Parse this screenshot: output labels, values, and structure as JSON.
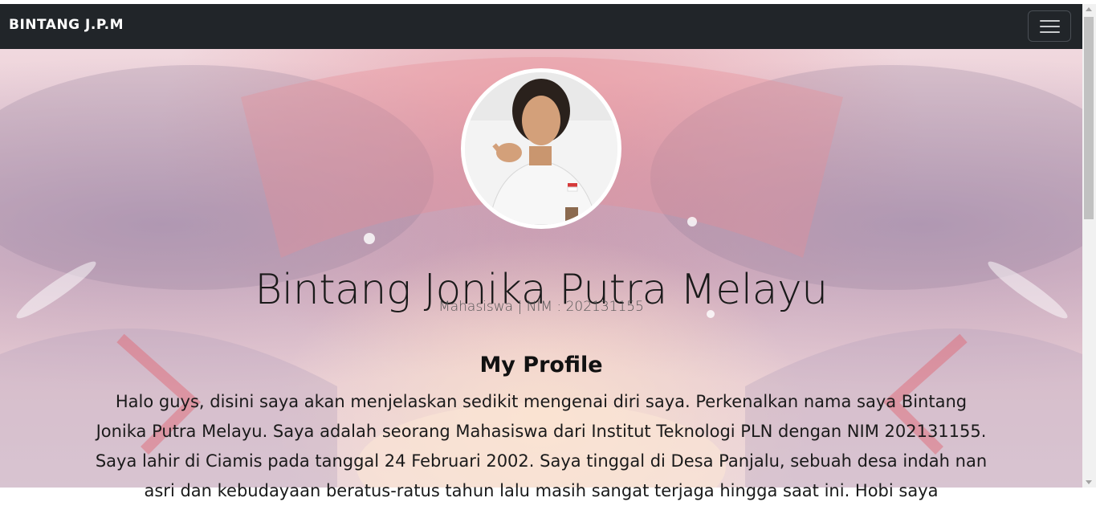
{
  "navbar": {
    "brand": "BINTANG J.P.M",
    "toggler_icon": "hamburger-menu-icon"
  },
  "profile": {
    "avatar_alt": "profile-photo",
    "name": "Bintang Jonika Putra Melayu",
    "subtitle": "Mahasiswa | NIM : 202131155",
    "section_title": "My Profile",
    "description": "Halo guys, disini saya akan menjelaskan sedikit mengenai diri saya. Perkenalkan nama saya Bintang Jonika Putra Melayu. Saya adalah seorang Mahasiswa dari Institut Teknologi PLN dengan NIM 202131155. Saya lahir di Ciamis pada tanggal 24 Februari 2002. Saya tinggal di Desa Panjalu, sebuah desa indah nan asri dan kebudayaan beratus-ratus tahun lalu masih sangat terjaga hingga saat ini. Hobi saya"
  },
  "colors": {
    "navbar_bg": "#212529",
    "text": "#1a1a1a"
  }
}
